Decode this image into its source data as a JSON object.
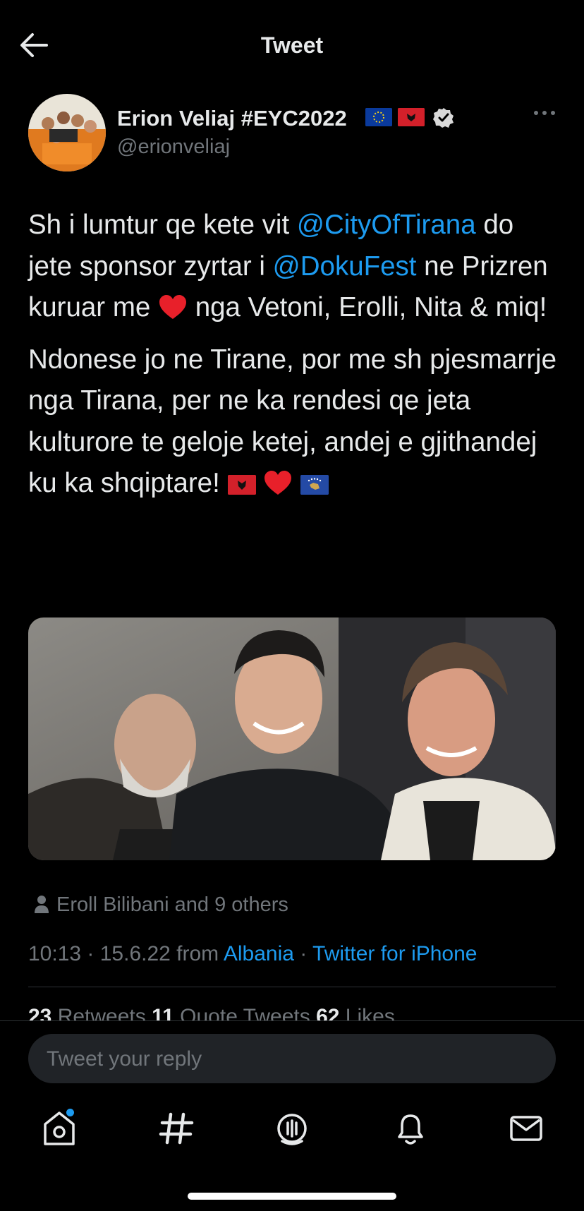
{
  "header": {
    "title": "Tweet",
    "back_icon": "arrow-left-icon"
  },
  "author": {
    "name": "Erion Veliaj #EYC2022",
    "handle": "@erionveliaj",
    "flags": [
      "eu-flag-icon",
      "albania-flag-icon"
    ],
    "verified_icon": "verified-badge-icon"
  },
  "tweet": {
    "paragraph1": {
      "t1": "Sh i lumtur qe kete vit ",
      "mention1": "@CityOfTirana",
      "t2": " do jete sponsor zyrtar i ",
      "mention2": "@DokuFest",
      "t3": " ne Prizren kuruar me ",
      "t4": " nga Vetoni, Erolli, Nita & miq!"
    },
    "paragraph2": {
      "text": "Ndonese jo ne Tirane, por me sh pjesmarrje nga Tirana, per ne ka rendesi qe jeta kulturore te geloje ketej, andej e gjithandej ku ka shqiptare! "
    }
  },
  "likers": {
    "text": "Eroll Bilibani and 9 others"
  },
  "meta": {
    "time": "10:13 · 15.6.22 from ",
    "location": "Albania",
    "separator": " · ",
    "source": "Twitter for iPhone"
  },
  "stats": {
    "retweets_count": "23",
    "retweets_label": " Retweets  ",
    "quotes_count": "11",
    "quotes_label": " Quote Tweets  ",
    "likes_count": "62",
    "likes_label": " Likes"
  },
  "reply": {
    "placeholder": "Tweet your reply"
  },
  "bottom_nav": [
    "home-icon",
    "explore-hashtag-icon",
    "spaces-icon",
    "notifications-bell-icon",
    "messages-envelope-icon"
  ],
  "colors": {
    "background": "#000000",
    "accent": "#1d9bf0",
    "secondary_text": "#71767b"
  }
}
